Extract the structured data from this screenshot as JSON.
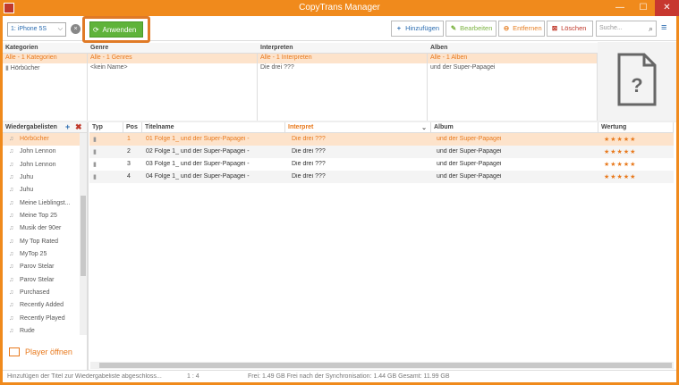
{
  "window": {
    "title": "CopyTrans Manager",
    "min": "—",
    "max": "☐",
    "close": "✕"
  },
  "toolbar": {
    "device": "1: iPhone 5S",
    "apply_label": "Anwenden",
    "add_label": "Hinzufügen",
    "edit_label": "Bearbeiten",
    "remove_label": "Entfernen",
    "delete_label": "Löschen",
    "search_placeholder": "Suche..."
  },
  "browser": {
    "categories_header": "Kategorien",
    "categories": [
      "Alle - 1 Kategorien",
      "Hörbücher"
    ],
    "genre_header": "Genre",
    "genres": [
      "Alle - 1 Genres",
      "<kein Name>"
    ],
    "artists_header": "Interpreten",
    "artists": [
      "Alle - 1 Interpreten",
      "Die drei ???"
    ],
    "albums_header": "Alben",
    "albums": [
      "Alle - 1 Alben",
      "und der Super-Papagei"
    ]
  },
  "playlists": {
    "header": "Wiedergabelisten",
    "add": "+",
    "delete": "✖",
    "items": [
      "Hörbücher",
      "John Lennon",
      "John Lennon",
      "Juhu",
      "Juhu",
      "Meine Lieblingst...",
      "Meine Top 25",
      "Musik der 90er",
      "My Top Rated",
      "MyTop 25",
      "Parov Stelar",
      "Parov Stelar",
      "Purchased",
      "Recently Added",
      "Recently Played",
      "Rude"
    ],
    "player_open": "Player öffnen"
  },
  "table": {
    "headers": {
      "type": "Typ",
      "pos": "Pos",
      "title": "Titelname",
      "artist": "Interpret",
      "album": "Album",
      "rating": "Wertung"
    },
    "rows": [
      {
        "pos": "1",
        "title": "01 Folge 1_ und der Super-Papagei -",
        "artist": "Die drei ???",
        "album": "und der Super-Papagei",
        "rating": "★★★★★"
      },
      {
        "pos": "2",
        "title": "02 Folge 1_ und der Super-Papagei -",
        "artist": "Die drei ???",
        "album": "und der Super-Papagei",
        "rating": "★★★★★"
      },
      {
        "pos": "3",
        "title": "03 Folge 1_ und der Super-Papagei -",
        "artist": "Die drei ???",
        "album": "und der Super-Papagei",
        "rating": "★★★★★"
      },
      {
        "pos": "4",
        "title": "04 Folge 1_ und der Super-Papagei -",
        "artist": "Die drei ???",
        "album": "und der Super-Papagei",
        "rating": "★★★★★"
      }
    ]
  },
  "status": {
    "message": "Hinzufügen der Titel zur Wiedergabeliste abgeschloss...",
    "count": "1 : 4",
    "storage": "Frei: 1.49 GB Frei nach der Synchronisation: 1.44 GB Gesamt: 11.99 GB"
  },
  "colors": {
    "accent": "#f08a1c",
    "apply_green": "#5fb33a",
    "selection": "#fde3cb",
    "link_blue": "#2b6cb0"
  },
  "icons": {
    "apply": "refresh-icon",
    "add": "plus-icon",
    "edit": "pencil-icon",
    "remove": "minus-circle-icon",
    "delete": "x-box-icon",
    "search": "search-icon",
    "menu": "hamburger-icon",
    "cover": "unknown-file-icon"
  }
}
